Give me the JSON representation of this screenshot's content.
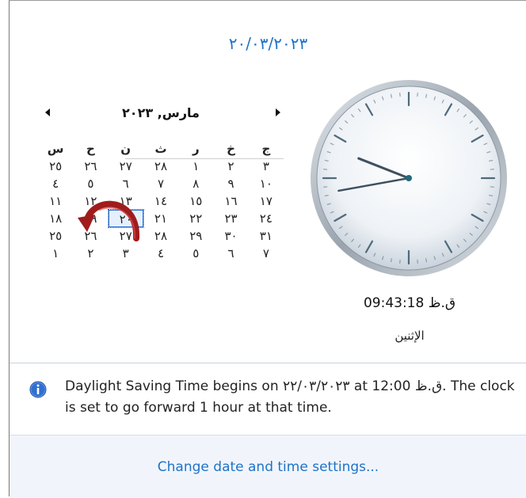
{
  "header": {
    "date": "٢٠/٠٣/٢٠٢٣"
  },
  "calendar": {
    "month_title": "مارس, ٢٠٢٣",
    "weekdays": [
      "س",
      "ح",
      "ن",
      "ث",
      "ر",
      "خ",
      "ج"
    ],
    "weeks": [
      [
        "٢٥",
        "٢٦",
        "٢٧",
        "٢٨",
        "١",
        "٢",
        "٣"
      ],
      [
        "٤",
        "٥",
        "٦",
        "٧",
        "٨",
        "٩",
        "١٠"
      ],
      [
        "١١",
        "١٢",
        "١٣",
        "١٤",
        "١٥",
        "١٦",
        "١٧"
      ],
      [
        "١٨",
        "١٩",
        "٢٠",
        "٢١",
        "٢٢",
        "٢٣",
        "٢٤"
      ],
      [
        "٢٥",
        "٢٦",
        "٢٧",
        "٢٨",
        "٢٩",
        "٣٠",
        "٣١"
      ],
      [
        "١",
        "٢",
        "٣",
        "٤",
        "٥",
        "٦",
        "٧"
      ]
    ],
    "today": "٢٠"
  },
  "clock": {
    "time": "09:43:18 ق.ظ",
    "day_name": "الإثنين",
    "hours": 9,
    "minutes": 43,
    "seconds": 18
  },
  "info": {
    "text": "Daylight Saving Time begins on ٢٢/٠٣/٢٠٢٣ at 12:00 ق.ظ. The clock is set to go forward 1 hour at that time.",
    "icon": "info-icon"
  },
  "footer": {
    "link": "Change date and time settings..."
  },
  "colors": {
    "accent": "#1e73c8",
    "arrow": "#a01c1c"
  }
}
